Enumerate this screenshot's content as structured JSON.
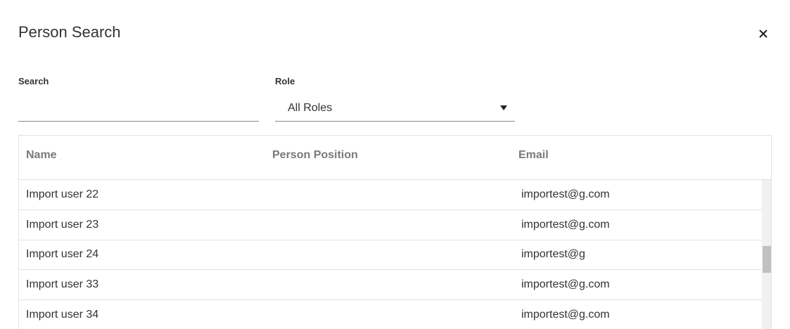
{
  "dialog": {
    "title": "Person Search",
    "close_icon": "close-icon"
  },
  "filters": {
    "search_label": "Search",
    "search_value": "",
    "search_placeholder": "",
    "role_label": "Role",
    "role_value": "All Roles",
    "role_icon": "caret-down-icon"
  },
  "table": {
    "columns": [
      "Name",
      "Person Position",
      "Email"
    ],
    "rows": [
      {
        "name": "Import user 22",
        "position": "",
        "email": "importest@g.com"
      },
      {
        "name": "Import user 23",
        "position": "",
        "email": "importest@g.com"
      },
      {
        "name": "Import user 24",
        "position": "",
        "email": "importest@g"
      },
      {
        "name": "Import user 33",
        "position": "",
        "email": "importest@g.com"
      },
      {
        "name": "Import user 34",
        "position": "",
        "email": "importest@g.com"
      }
    ]
  }
}
